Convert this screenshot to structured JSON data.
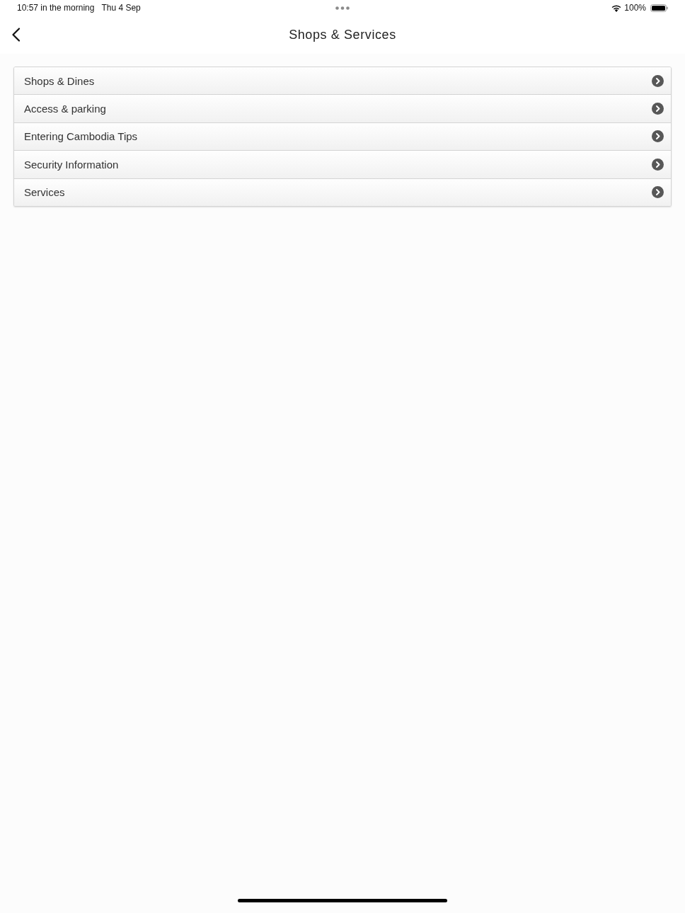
{
  "status_bar": {
    "time": "10:57 in the morning",
    "date": "Thu 4 Sep",
    "battery": "100%"
  },
  "nav_bar": {
    "title": "Shops & Services"
  },
  "menu": {
    "items": [
      {
        "label": "Shops & Dines"
      },
      {
        "label": "Access & parking"
      },
      {
        "label": "Entering Cambodia Tips"
      },
      {
        "label": "Security Information"
      },
      {
        "label": "Services"
      }
    ]
  }
}
